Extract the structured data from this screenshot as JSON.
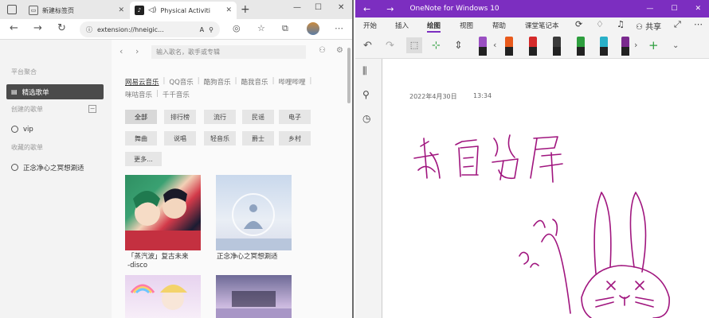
{
  "browser": {
    "tabs": [
      {
        "label": "新建标签页"
      },
      {
        "label": "Physical Activiti"
      }
    ],
    "url": "extension://hneigic...",
    "sidebar": {
      "platform_label": "平台聚合",
      "selected_item": "精选歌单",
      "created_label": "创建的歌单",
      "vip_item": "vip",
      "collected_label": "收藏的歌单",
      "collected_item": "正念净心之冥想涮适"
    },
    "search_placeholder": "输入歌名，歌手或专辑",
    "sources": [
      "网易云音乐",
      "QQ音乐",
      "酷狗音乐",
      "酷我音乐",
      "哔哩哔哩",
      "咪咕音乐",
      "千千音乐"
    ],
    "categories": [
      "全部",
      "排行榜",
      "流行",
      "民谣",
      "电子",
      "舞曲",
      "说唱",
      "轻音乐",
      "爵士",
      "乡村",
      "更多..."
    ],
    "playlists": [
      {
        "title_line1": "「蒸汽波」复古未来",
        "title_line2": "-disco"
      },
      {
        "title_line1": "正念净心之冥想涮适",
        "title_line2": ""
      },
      {
        "title_line1": "",
        "title_line2": ""
      },
      {
        "title_line1": "",
        "title_line2": ""
      }
    ]
  },
  "onenote": {
    "title": "OneNote for Windows 10",
    "menu": [
      "开始",
      "插入",
      "绘图",
      "视图",
      "帮助",
      "课堂笔记本"
    ],
    "share_label": "共享",
    "date": "2022年4月30日",
    "time": "13:34",
    "pen_colors": [
      "#9a4fc2",
      "#e85a1c",
      "#d42a2a",
      "#3a3a3a",
      "#2e9e3e",
      "#2ab0c8",
      "#7a2a8e",
      "#222222"
    ],
    "accent": "#7c2ec0",
    "ink_color": "#a0157e"
  }
}
